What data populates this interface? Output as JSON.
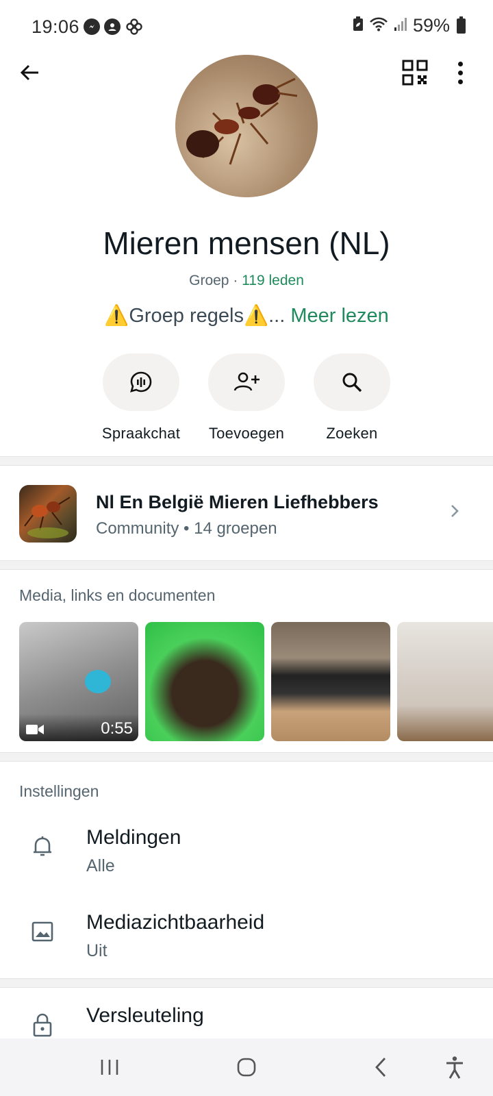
{
  "status_bar": {
    "time": "19:06",
    "battery": "59%",
    "left_icons": [
      "messenger-icon",
      "account-icon",
      "pinwheel-icon"
    ],
    "right_icons": [
      "battery-saver-icon",
      "wifi-icon",
      "signal-icon",
      "battery-icon"
    ]
  },
  "header": {
    "back_icon": "arrow-back-icon",
    "qr_icon": "qr-code-icon",
    "more_icon": "more-vert-icon"
  },
  "group": {
    "name": "Mieren mensen (NL)",
    "type": "Groep",
    "separator": " · ",
    "members": "119 leden",
    "description": "⚠️Groep regels⚠️...",
    "read_more": "Meer lezen"
  },
  "actions": [
    {
      "label": "Spraakchat",
      "icon": "voice-chat-icon"
    },
    {
      "label": "Toevoegen",
      "icon": "add-person-icon"
    },
    {
      "label": "Zoeken",
      "icon": "search-icon"
    }
  ],
  "community": {
    "title": "Nl En België Mieren Liefhebbers",
    "subtitle": "Community • 14 groepen"
  },
  "media": {
    "title": "Media, links en documenten",
    "video_duration": "0:55"
  },
  "settings": {
    "title": "Instellingen",
    "notifications_title": "Meldingen",
    "notifications_value": "Alle",
    "media_title": "Mediazichtbaarheid",
    "media_value": "Uit",
    "encryption_title": "Versleuteling"
  },
  "colors": {
    "accent_green": "#1f8a5b",
    "text_primary": "#111b21",
    "text_secondary": "#54656f",
    "chip_bg": "#f3f2f0"
  }
}
